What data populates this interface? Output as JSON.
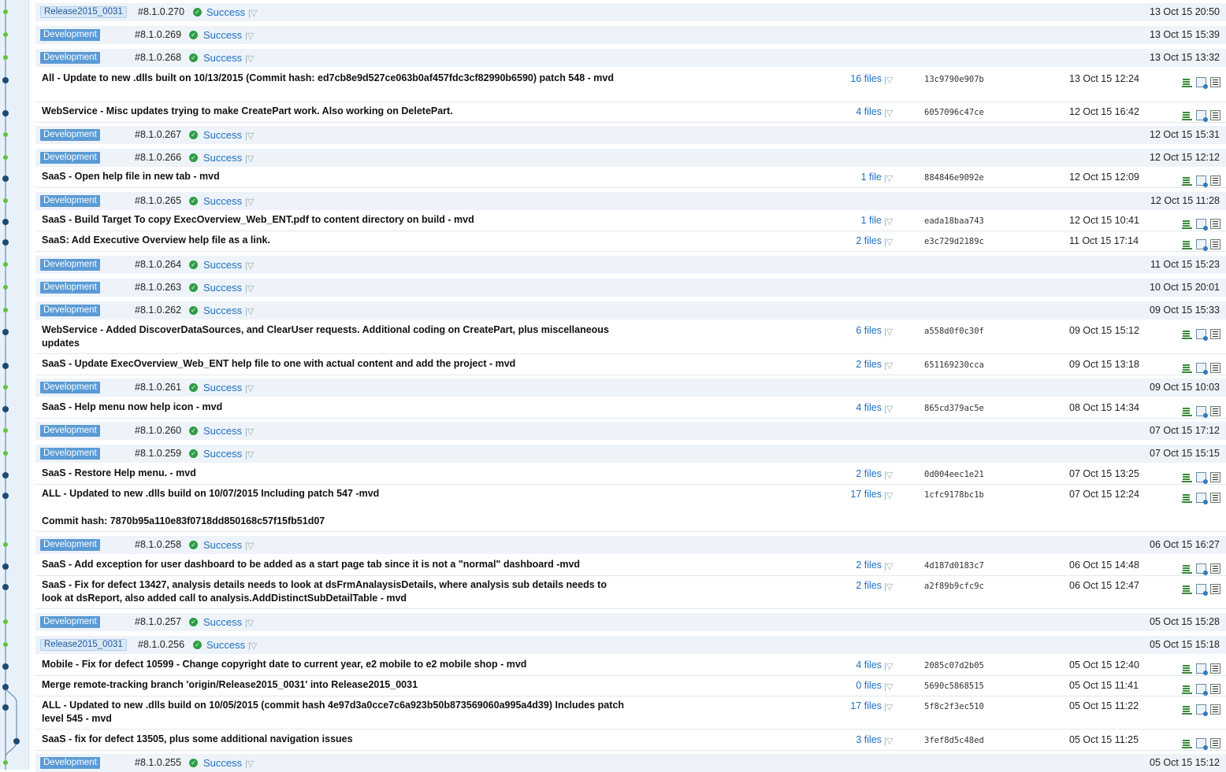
{
  "colors": {
    "accent": "#1f6fbf",
    "success": "#2e9e44",
    "tag_dev": "#5b9bd5",
    "graph_build": "#5fc43a",
    "graph_commit": "#1d4b73"
  },
  "icons": {
    "status": "check-circle-icon",
    "dropdown": "chevron-down-icon",
    "action1": "changes-icon",
    "action2": "pin-icon",
    "action3": "compare-icon"
  },
  "rows": [
    {
      "kind": "build",
      "tag": "Release2015_0031",
      "number": "#8.1.0.270",
      "status": "Success",
      "date": "13 Oct 15 20:50"
    },
    {
      "kind": "build",
      "tag": "Development",
      "number": "#8.1.0.269",
      "status": "Success",
      "date": "13 Oct 15 15:39"
    },
    {
      "kind": "build",
      "tag": "Development",
      "number": "#8.1.0.268",
      "status": "Success",
      "date": "13 Oct 15 13:32"
    },
    {
      "kind": "commit",
      "message": "All - Update to new .dlls built on 10/13/2015 (Commit hash: ed7cb8e9d527ce063b0af457fdc3cf82990b6590) patch 548 - mvd",
      "files": "16 files",
      "hash": "13c9790e907b",
      "date": "13 Oct 15 12:24"
    },
    {
      "kind": "commit",
      "message": "WebService - Misc updates trying to make CreatePart work. Also working on DeletePart.",
      "files": "4 files",
      "hash": "6057096c47ce",
      "date": "12 Oct 15 16:42"
    },
    {
      "kind": "build",
      "tag": "Development",
      "number": "#8.1.0.267",
      "status": "Success",
      "date": "12 Oct 15 15:31"
    },
    {
      "kind": "build",
      "tag": "Development",
      "number": "#8.1.0.266",
      "status": "Success",
      "date": "12 Oct 15 12:12"
    },
    {
      "kind": "commit",
      "message": "SaaS - Open help file in new tab - mvd",
      "files": "1 file",
      "hash": "884846e9092e",
      "date": "12 Oct 15 12:09"
    },
    {
      "kind": "build",
      "tag": "Development",
      "number": "#8.1.0.265",
      "status": "Success",
      "date": "12 Oct 15 11:28"
    },
    {
      "kind": "commit",
      "message": "SaaS - Build Target To copy ExecOverview_Web_ENT.pdf to content directory on build - mvd",
      "files": "1 file",
      "hash": "eada18baa743",
      "date": "12 Oct 15 10:41"
    },
    {
      "kind": "commit",
      "message": "SaaS: Add Executive Overview help file as a link.",
      "files": "2 files",
      "hash": "e3c729d2189c",
      "date": "11 Oct 15 17:14"
    },
    {
      "kind": "build",
      "tag": "Development",
      "number": "#8.1.0.264",
      "status": "Success",
      "date": "11 Oct 15 15:23"
    },
    {
      "kind": "build",
      "tag": "Development",
      "number": "#8.1.0.263",
      "status": "Success",
      "date": "10 Oct 15 20:01"
    },
    {
      "kind": "build",
      "tag": "Development",
      "number": "#8.1.0.262",
      "status": "Success",
      "date": "09 Oct 15 15:33"
    },
    {
      "kind": "commit",
      "message": "WebService - Added DiscoverDataSources, and ClearUser requests. Additional coding on CreatePart, plus miscellaneous updates",
      "files": "6 files",
      "hash": "a558d0f0c30f",
      "date": "09 Oct 15 15:12"
    },
    {
      "kind": "commit",
      "message": "SaaS - Update ExecOverview_Web_ENT help file to one with actual content and add the project - mvd",
      "files": "2 files",
      "hash": "651169230cca",
      "date": "09 Oct 15 13:18"
    },
    {
      "kind": "build",
      "tag": "Development",
      "number": "#8.1.0.261",
      "status": "Success",
      "date": "09 Oct 15 10:03"
    },
    {
      "kind": "commit",
      "message": "SaaS - Help menu now help icon - mvd",
      "files": "4 files",
      "hash": "865cd379ac5e",
      "date": "08 Oct 15 14:34"
    },
    {
      "kind": "build",
      "tag": "Development",
      "number": "#8.1.0.260",
      "status": "Success",
      "date": "07 Oct 15 17:12"
    },
    {
      "kind": "build",
      "tag": "Development",
      "number": "#8.1.0.259",
      "status": "Success",
      "date": "07 Oct 15 15:15"
    },
    {
      "kind": "commit",
      "message": "SaaS - Restore Help menu. - mvd",
      "files": "2 files",
      "hash": "0d004eec1e21",
      "date": "07 Oct 15 13:25"
    },
    {
      "kind": "commit",
      "message": "ALL - Updated to new .dlls build on 10/07/2015 Including patch 547 -mvd",
      "message2": "Commit hash: 7870b95a110e83f0718dd850168c57f15fb51d07",
      "files": "17 files",
      "hash": "1cfc9178bc1b",
      "date": "07 Oct 15 12:24"
    },
    {
      "kind": "build",
      "tag": "Development",
      "number": "#8.1.0.258",
      "status": "Success",
      "date": "06 Oct 15 16:27"
    },
    {
      "kind": "commit",
      "message": "SaaS - Add exception for user dashboard to be added as a start page tab since it is not a \"normal\" dashboard -mvd",
      "files": "2 files",
      "hash": "4d187d0183c7",
      "date": "06 Oct 15 14:48"
    },
    {
      "kind": "commit",
      "message": "SaaS - Fix for defect 13427, analysis details needs to look at dsFrmAnalaysisDetails, where analysis sub details needs to look at dsReport, also added call to analysis.AddDistinctSubDetailTable - mvd",
      "files": "2 files",
      "hash": "a2f89b9cfc9c",
      "date": "06 Oct 15 12:47"
    },
    {
      "kind": "build",
      "tag": "Development",
      "number": "#8.1.0.257",
      "status": "Success",
      "date": "05 Oct 15 15:28"
    },
    {
      "kind": "build",
      "tag": "Release2015_0031",
      "number": "#8.1.0.256",
      "status": "Success",
      "date": "05 Oct 15 15:18"
    },
    {
      "kind": "commit",
      "message": "Mobile - Fix for defect 10599 - Change copyright date to current year, e2 mobile to e2 mobile shop - mvd",
      "files": "4 files",
      "hash": "2085c07d2b05",
      "date": "05 Oct 15 12:40"
    },
    {
      "kind": "commit",
      "message": "Merge remote-tracking branch 'origin/Release2015_0031' into Release2015_0031",
      "files": "0 files",
      "hash": "5690c5868515",
      "date": "05 Oct 15 11:41"
    },
    {
      "kind": "commit",
      "message": "ALL - Updated to new .dlls build on 10/05/2015 (commit hash 4e97d3a0cce7c6a923b50b873569060a995a4d39) Includes patch level 545 - mvd",
      "files": "17 files",
      "hash": "5f8c2f3ec510",
      "date": "05 Oct 15 11:22"
    },
    {
      "kind": "commit",
      "message": "SaaS - fix for defect 13505, plus some additional navigation issues",
      "files": "3 files",
      "hash": "3fef8d5c48ed",
      "date": "05 Oct 15 11:25"
    },
    {
      "kind": "build",
      "tag": "Development",
      "number": "#8.1.0.255",
      "status": "Success",
      "date": "05 Oct 15 15:12"
    }
  ]
}
